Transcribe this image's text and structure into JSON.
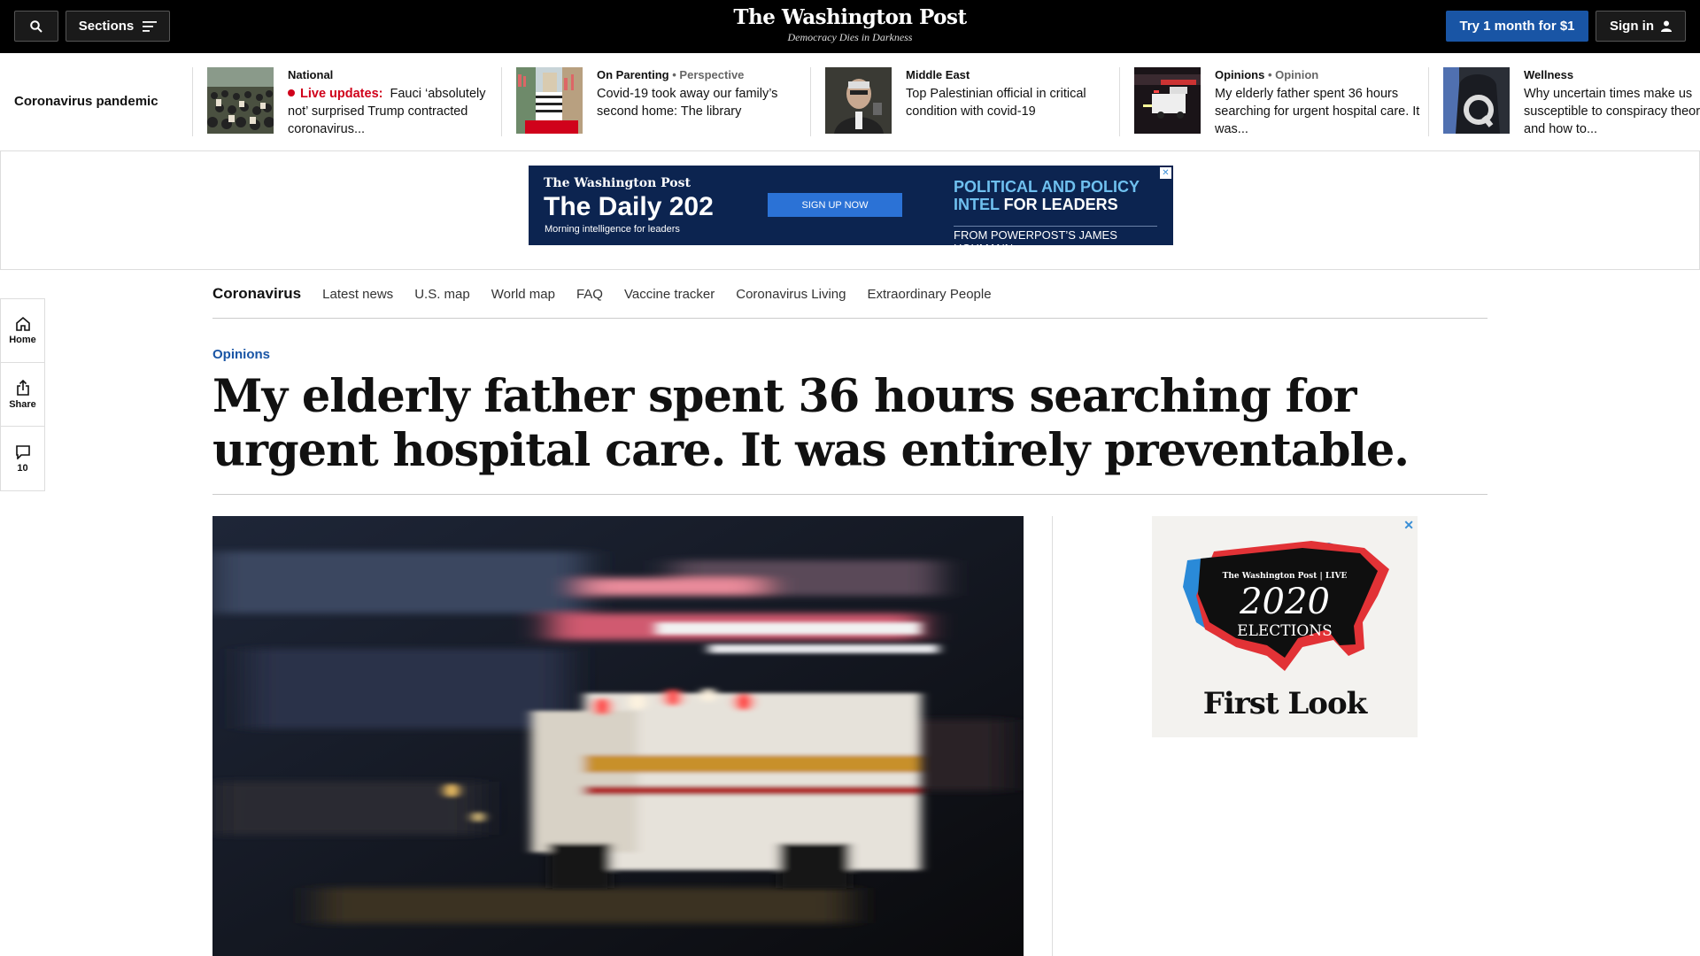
{
  "topbar": {
    "sections_label": "Sections",
    "logo": "The Washington Post",
    "tagline": "Democracy Dies in Darkness",
    "try_label": "Try 1 month for $1",
    "sign_in_label": "Sign in"
  },
  "strip": {
    "label": "Coronavirus pandemic",
    "items": [
      {
        "kicker": "National",
        "kicker_sub": "",
        "live_label": "Live updates:",
        "headline": "Fauci ‘absolutely not’ surprised Trump contracted coronavirus..."
      },
      {
        "kicker": "On Parenting",
        "kicker_sub": "• Perspective",
        "live_label": "",
        "headline": "Covid-19 took away our family’s second home: The library"
      },
      {
        "kicker": "Middle East",
        "kicker_sub": "",
        "live_label": "",
        "headline": "Top Palestinian official in critical condition with covid-19"
      },
      {
        "kicker": "Opinions",
        "kicker_sub": "• Opinion",
        "live_label": "",
        "headline": "My elderly father spent 36 hours searching for urgent hospital care. It was..."
      },
      {
        "kicker": "Wellness",
        "kicker_sub": "",
        "live_label": "",
        "headline": "Why uncertain times make us susceptible to conspiracy theories — and how to..."
      }
    ]
  },
  "ad_banner": {
    "brand": "The Washington Post",
    "title": "The Daily 202",
    "subtitle": "Morning intelligence for leaders",
    "cta": "SIGN UP NOW",
    "tagline_1": "POLITICAL AND POLICY",
    "tagline_2a": "INTEL ",
    "tagline_2b": "FOR LEADERS",
    "from": "FROM POWERPOST’S JAMES HOHMANN"
  },
  "sidebar": {
    "home_label": "Home",
    "share_label": "Share",
    "comments_count": "10"
  },
  "section_nav": {
    "title": "Coronavirus",
    "links": [
      "Latest news",
      "U.S. map",
      "World map",
      "FAQ",
      "Vaccine tracker",
      "Coronavirus Living",
      "Extraordinary People"
    ]
  },
  "article": {
    "kicker": "Opinions",
    "headline": "My elderly father spent 36 hours searching for urgent hospital care. It was entirely preventable."
  },
  "side_ad": {
    "brand": "The Washington Post | LIVE",
    "year": "2020",
    "elections": "ELECTIONS",
    "first_look": "First Look"
  },
  "colors": {
    "accent_blue": "#1955a5",
    "live_red": "#d0021b",
    "topbar_bg": "#000000"
  }
}
